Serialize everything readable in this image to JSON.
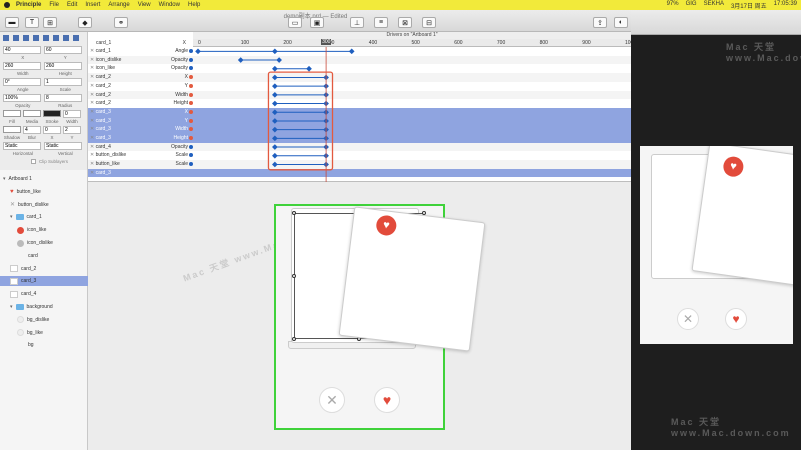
{
  "menubar": {
    "app": "Principle",
    "items": [
      "File",
      "Edit",
      "Insert",
      "Arrange",
      "View",
      "Window",
      "Help"
    ],
    "status": [
      "97%",
      "GIG",
      "SEKHA",
      "3月17日 周五",
      "17:05:39"
    ]
  },
  "toolbar": {
    "doc_title": "demo副本.prd — Edited"
  },
  "props": {
    "x": "40",
    "y": "60",
    "width": "260",
    "height": "260",
    "angle": "0°",
    "scale": "1",
    "opacity": "100%",
    "radius": "8",
    "border": "0",
    "shadow": "0",
    "horizontal": "Static",
    "vertical": "Static",
    "labels": {
      "x": "X",
      "y": "Y",
      "width": "Width",
      "height": "Height",
      "angle": "Angle",
      "scale": "Scale",
      "opacity": "Opacity",
      "radius": "Radius",
      "fill": "Fill",
      "media": "Media",
      "stroke": "Stroke",
      "width2": "Width",
      "shadow": "Shadow",
      "blur": "Blur",
      "sx": "X",
      "sy": "Y",
      "horizontal": "Horizontal",
      "vertical": "Vertical",
      "clip": "Clip Sublayers"
    },
    "blur": "4",
    "shadow_x": "0",
    "shadow_y": "2"
  },
  "layers": [
    {
      "name": "Artboard 1",
      "kind": "root",
      "indent": 0
    },
    {
      "name": "button_like",
      "kind": "heart",
      "indent": 1
    },
    {
      "name": "button_dislike",
      "kind": "x",
      "indent": 1
    },
    {
      "name": "card_1",
      "kind": "folder",
      "indent": 1
    },
    {
      "name": "icon_like",
      "kind": "red-circle",
      "indent": 2
    },
    {
      "name": "icon_dislike",
      "kind": "grey-circle",
      "indent": 2
    },
    {
      "name": "card",
      "kind": "none",
      "indent": 2
    },
    {
      "name": "card_2",
      "kind": "thumb",
      "indent": 1
    },
    {
      "name": "card_3",
      "kind": "thumb",
      "indent": 1,
      "selected": true
    },
    {
      "name": "card_4",
      "kind": "thumb",
      "indent": 1
    },
    {
      "name": "background",
      "kind": "folder",
      "indent": 1
    },
    {
      "name": "bg_dislike",
      "kind": "light-circle",
      "indent": 2
    },
    {
      "name": "bg_like",
      "kind": "light-circle",
      "indent": 2
    },
    {
      "name": "bg",
      "kind": "none",
      "indent": 2
    }
  ],
  "drivers": {
    "title": "Drivers on \"Artboard 1\"",
    "header_name": "card_1",
    "header_prop": "X",
    "ticks": [
      "0",
      "100",
      "200",
      "300",
      "400",
      "500",
      "600",
      "700",
      "800",
      "900",
      "1000"
    ],
    "scrub_value": "300",
    "scrub_at": 300,
    "rows": [
      {
        "name": "card_1",
        "prop": "Angle",
        "from": 0,
        "to": 360,
        "knots": [
          180
        ],
        "dot": "blue"
      },
      {
        "name": "icon_dislike",
        "prop": "Opacity",
        "from": 100,
        "to": 190,
        "knots": [],
        "dot": "blue"
      },
      {
        "name": "icon_like",
        "prop": "Opacity",
        "from": 180,
        "to": 260,
        "knots": [],
        "dot": "blue"
      },
      {
        "name": "card_2",
        "prop": "X",
        "from": 180,
        "to": 300,
        "knots": [],
        "dot": "red"
      },
      {
        "name": "card_2",
        "prop": "Y",
        "from": 180,
        "to": 300,
        "knots": [],
        "dot": "red"
      },
      {
        "name": "card_2",
        "prop": "Width",
        "from": 180,
        "to": 300,
        "knots": [],
        "dot": "red"
      },
      {
        "name": "card_2",
        "prop": "Height",
        "from": 180,
        "to": 300,
        "knots": [],
        "dot": "red"
      },
      {
        "name": "card_3",
        "prop": "X",
        "from": 180,
        "to": 300,
        "knots": [],
        "dot": "red",
        "selected": true
      },
      {
        "name": "card_3",
        "prop": "Y",
        "from": 180,
        "to": 300,
        "knots": [],
        "dot": "red",
        "selected": true
      },
      {
        "name": "card_3",
        "prop": "Width",
        "from": 180,
        "to": 300,
        "knots": [],
        "dot": "red",
        "selected": true
      },
      {
        "name": "card_3",
        "prop": "Height",
        "from": 180,
        "to": 300,
        "knots": [],
        "dot": "red",
        "selected": true
      },
      {
        "name": "card_4",
        "prop": "Opacity",
        "from": 180,
        "to": 300,
        "knots": [],
        "dot": "blue"
      },
      {
        "name": "button_dislike",
        "prop": "Scale",
        "from": 180,
        "to": 300,
        "knots": [],
        "dot": "blue"
      },
      {
        "name": "button_like",
        "prop": "Scale",
        "from": 180,
        "to": 300,
        "knots": [],
        "dot": "blue"
      },
      {
        "name": "card_3",
        "prop": "",
        "from": null,
        "to": null,
        "knots": [],
        "dot": "none",
        "selected": true
      }
    ]
  },
  "colors": {
    "accent": "#1f5fbf",
    "highlight_box": "#e35a3f",
    "artboard_border": "#3fd23a",
    "like_red": "#e24b3b",
    "selection": "#8fa4e0"
  },
  "watermark": "Mac 天堂 www.Mac.down.com"
}
